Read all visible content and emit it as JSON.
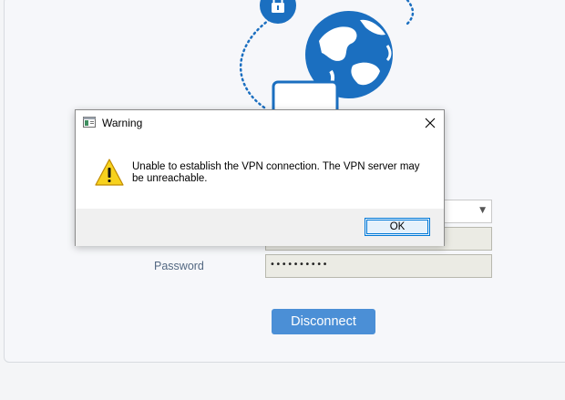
{
  "vpn_form": {
    "password_label": "Password",
    "password_masked": "••••••••••",
    "disconnect_label": "Disconnect"
  },
  "dialog": {
    "title": "Warning",
    "message": "Unable to establish the VPN connection. The VPN server may be unreachable.",
    "ok_label": "OK"
  },
  "icons": {
    "title": "app-window-icon",
    "warning": "warning-triangle-icon",
    "close": "close-icon",
    "lock": "lock-icon",
    "globe": "globe-icon",
    "laptop": "laptop-icon"
  },
  "colors": {
    "brand_blue": "#1b6fc0",
    "button_blue": "#4b8fd6",
    "label_slate": "#536882",
    "warning_yellow": "#f7d21e",
    "focus_blue": "#0078d7"
  }
}
